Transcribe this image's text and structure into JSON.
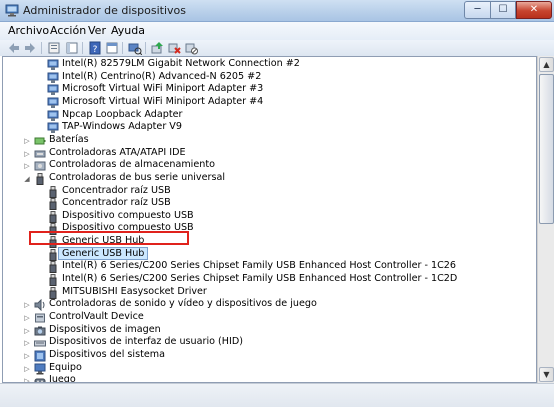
{
  "window": {
    "title": "Administrador de dispositivos",
    "min_symbol": "─",
    "max_symbol": "☐",
    "close_symbol": "✕"
  },
  "menu": [
    "Archivo",
    "Acción",
    "Ver",
    "Ayuda"
  ],
  "toolbar_icons": [
    "back-arrow-icon",
    "forward-arrow-icon",
    "properties-icon",
    "console-tree-icon",
    "help-icon",
    "scan-hardware-icon",
    "update-driver-icon",
    "uninstall-icon",
    "disable-icon"
  ],
  "tree": [
    {
      "label": "Intel(R) 82579LM Gigabit Network Connection #2",
      "level": 2,
      "icon": "network-adapter-icon"
    },
    {
      "label": "Intel(R) Centrino(R) Advanced-N 6205 #2",
      "level": 2,
      "icon": "network-adapter-icon"
    },
    {
      "label": "Microsoft Virtual WiFi Miniport Adapter #3",
      "level": 2,
      "icon": "network-adapter-icon"
    },
    {
      "label": "Microsoft Virtual WiFi Miniport Adapter #4",
      "level": 2,
      "icon": "network-adapter-icon"
    },
    {
      "label": "Npcap Loopback Adapter",
      "level": 2,
      "icon": "network-adapter-icon"
    },
    {
      "label": "TAP-Windows Adapter V9",
      "level": 2,
      "icon": "network-adapter-icon"
    },
    {
      "label": "Baterías",
      "level": 1,
      "icon": "battery-icon",
      "state": "collapsed"
    },
    {
      "label": "Controladoras ATA/ATAPI IDE",
      "level": 1,
      "icon": "ide-controller-icon",
      "state": "collapsed"
    },
    {
      "label": "Controladoras de almacenamiento",
      "level": 1,
      "icon": "storage-controller-icon",
      "state": "collapsed"
    },
    {
      "label": "Controladoras de bus serie universal",
      "level": 1,
      "icon": "usb-icon",
      "state": "expanded"
    },
    {
      "label": "Concentrador raíz USB",
      "level": 2,
      "icon": "usb-icon"
    },
    {
      "label": "Concentrador raíz USB",
      "level": 2,
      "icon": "usb-icon"
    },
    {
      "label": "Dispositivo compuesto USB",
      "level": 2,
      "icon": "usb-icon"
    },
    {
      "label": "Dispositivo compuesto USB",
      "level": 2,
      "icon": "usb-icon"
    },
    {
      "label": "Generic USB Hub",
      "level": 2,
      "icon": "usb-icon"
    },
    {
      "label": "Generic USB Hub",
      "level": 2,
      "icon": "usb-icon",
      "selected": true
    },
    {
      "label": "Intel(R) 6 Series/C200 Series Chipset Family USB Enhanced Host Controller - 1C26",
      "level": 2,
      "icon": "usb-icon"
    },
    {
      "label": "Intel(R) 6 Series/C200 Series Chipset Family USB Enhanced Host Controller - 1C2D",
      "level": 2,
      "icon": "usb-icon"
    },
    {
      "label": "MITSUBISHI Easysocket Driver",
      "level": 2,
      "icon": "usb-icon",
      "highlighted": true
    },
    {
      "label": "Controladoras de sonido y vídeo y dispositivos de juego",
      "level": 1,
      "icon": "sound-icon",
      "state": "collapsed"
    },
    {
      "label": "ControlVault Device",
      "level": 1,
      "icon": "generic-device-icon",
      "state": "collapsed"
    },
    {
      "label": "Dispositivos de imagen",
      "level": 1,
      "icon": "camera-icon",
      "state": "collapsed"
    },
    {
      "label": "Dispositivos de interfaz de usuario (HID)",
      "level": 1,
      "icon": "hid-icon",
      "state": "collapsed"
    },
    {
      "label": "Dispositivos del sistema",
      "level": 1,
      "icon": "system-devices-icon",
      "state": "collapsed"
    },
    {
      "label": "Equipo",
      "level": 1,
      "icon": "computer-icon",
      "state": "collapsed"
    },
    {
      "label": "Juego",
      "level": 1,
      "icon": "game-icon",
      "state": "collapsed"
    }
  ],
  "colors": {
    "selection": "#cce8ff",
    "highlight_box": "#e0221c",
    "titlebar": "#b9d0ea"
  }
}
